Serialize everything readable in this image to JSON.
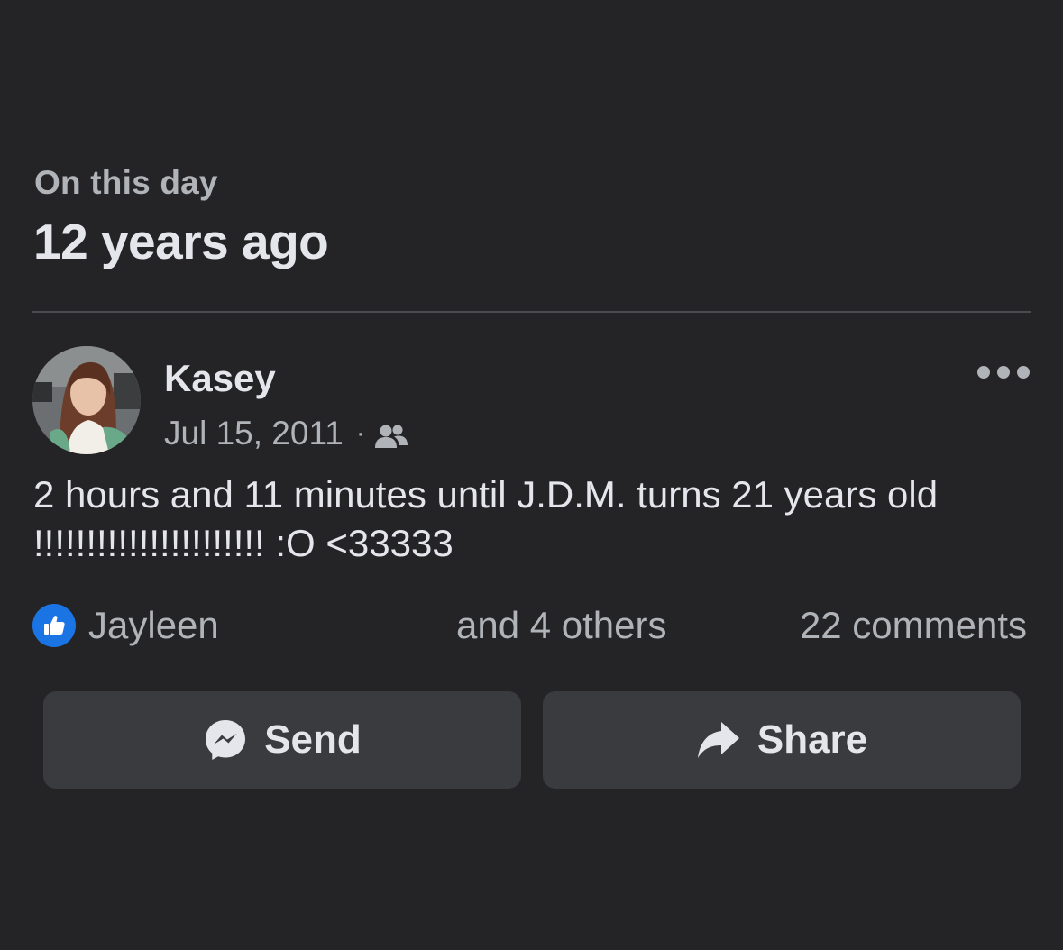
{
  "memory": {
    "subtitle": "On this day",
    "title": "12 years ago"
  },
  "post": {
    "author": "Kasey",
    "date": "Jul 15, 2011",
    "meta_separator": "·",
    "audience_icon": "friends-icon",
    "text": "2 hours and 11 minutes until J.D.M. turns 21 years old !!!!!!!!!!!!!!!!!!!!!! :O <33333"
  },
  "reactions": {
    "icon": "like-icon",
    "first_name": "Jayleen",
    "others": "and 4 others",
    "comments": "22 comments"
  },
  "actions": {
    "send_label": "Send",
    "send_icon": "messenger-icon",
    "share_label": "Share",
    "share_icon": "share-arrow-icon"
  },
  "colors": {
    "background": "#242427",
    "button_bg": "#3a3b3e",
    "like_blue": "#1b74e4",
    "primary_text": "#e4e6eb",
    "secondary_text": "#b0b3b8"
  }
}
